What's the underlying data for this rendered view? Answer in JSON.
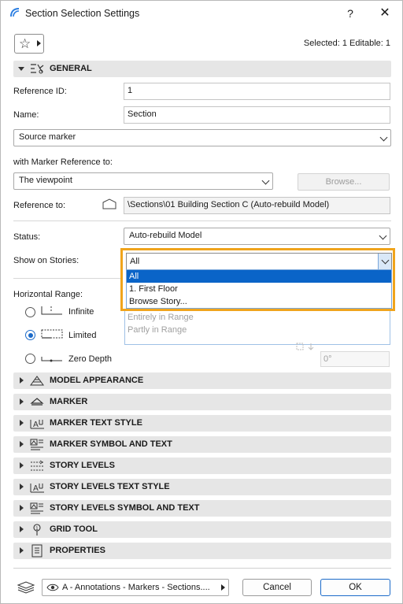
{
  "window": {
    "title": "Section Selection Settings",
    "help_glyph": "?",
    "close_glyph": "✕"
  },
  "toolbar": {
    "selection_info": "Selected: 1 Editable: 1",
    "favorites_icon": "star-icon"
  },
  "general": {
    "header": "GENERAL",
    "reference_id_label": "Reference ID:",
    "reference_id_value": "1",
    "name_label": "Name:",
    "name_value": "Section",
    "marker_type_value": "Source marker",
    "marker_reference_label": "with Marker Reference to:",
    "marker_reference_value": "The viewpoint",
    "browse_label": "Browse...",
    "reference_to_label": "Reference to:",
    "reference_to_value": "\\Sections\\01 Building Section C (Auto-rebuild Model)",
    "status_label": "Status:",
    "status_value": "Auto-rebuild Model",
    "show_on_stories_label": "Show on Stories:",
    "show_on_stories_value": "All",
    "show_on_stories_options": [
      "All",
      "1. First Floor",
      "Browse Story..."
    ],
    "show_on_stories_selected_index": 0,
    "horizontal_range_label": "Horizontal Range:",
    "range_options": [
      {
        "label": "Infinite",
        "checked": false
      },
      {
        "label": "Limited",
        "checked": true
      },
      {
        "label": "Zero Depth",
        "checked": false
      }
    ],
    "range_list_items": [
      "Entirely in Range",
      "Partly in Range"
    ],
    "angle_value": "0°"
  },
  "panels": [
    {
      "label": "MODEL APPEARANCE",
      "icon": "model-appearance-icon"
    },
    {
      "label": "MARKER",
      "icon": "marker-icon"
    },
    {
      "label": "MARKER TEXT STYLE",
      "icon": "text-style-icon"
    },
    {
      "label": "MARKER SYMBOL AND TEXT",
      "icon": "symbol-text-icon"
    },
    {
      "label": "STORY LEVELS",
      "icon": "story-levels-icon"
    },
    {
      "label": "STORY LEVELS TEXT STYLE",
      "icon": "text-style-icon"
    },
    {
      "label": "STORY LEVELS SYMBOL AND TEXT",
      "icon": "symbol-text-icon"
    },
    {
      "label": "GRID TOOL",
      "icon": "grid-tool-icon"
    },
    {
      "label": "PROPERTIES",
      "icon": "properties-icon"
    }
  ],
  "footer": {
    "layer_value": "A - Annotations - Markers - Sections....",
    "cancel_label": "Cancel",
    "ok_label": "OK"
  },
  "colors": {
    "accent": "#1b6ac9",
    "highlight_frame": "#f0a41c",
    "selected_option": "#0a64c8",
    "panel_header": "#e6e6e6"
  }
}
